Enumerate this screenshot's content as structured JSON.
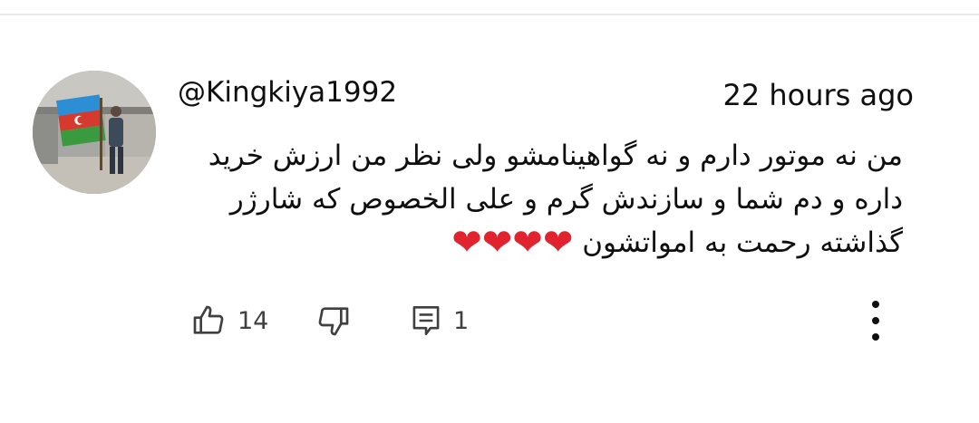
{
  "comment": {
    "author": "@Kingkiya1992",
    "timestamp": "22 hours ago",
    "text_lines": [
      "من نه موتور دارم و نه گواهینامشو ولی نظر من ارزش خرید",
      "داره و دم شما و سازندش گرم و علی الخصوص که شارژر",
      "گذاشته رحمت به امواتشون"
    ],
    "hearts": "❤❤❤❤"
  },
  "actions": {
    "like_count": "14",
    "reply_count": "1"
  },
  "icons": {
    "like": "thumbs-up-icon",
    "dislike": "thumbs-down-icon",
    "reply": "reply-comment-icon",
    "more": "more-vertical-icon"
  },
  "colors": {
    "heart": "#e0232e",
    "text": "#0f0f0f",
    "secondary": "#404040"
  }
}
